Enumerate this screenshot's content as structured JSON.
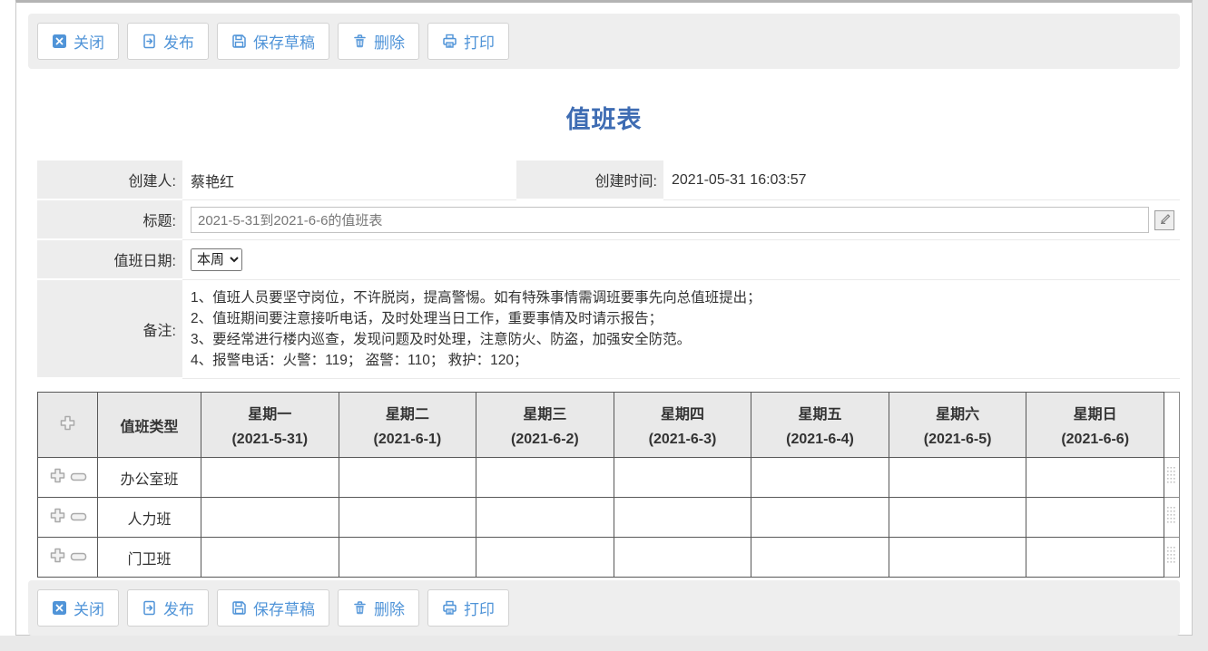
{
  "page": {
    "title": "值班表"
  },
  "colors": {
    "accent_blue": "#5094d8",
    "title_blue": "#3e6cb3"
  },
  "toolbar": {
    "buttons": [
      {
        "name": "close",
        "icon": "close-icon",
        "label": "关闭"
      },
      {
        "name": "publish",
        "icon": "publish-icon",
        "label": "发布"
      },
      {
        "name": "save-draft",
        "icon": "save-icon",
        "label": "保存草稿"
      },
      {
        "name": "delete",
        "icon": "delete-icon",
        "label": "删除"
      },
      {
        "name": "print",
        "icon": "print-icon",
        "label": "打印"
      }
    ]
  },
  "form": {
    "creator_label": "创建人:",
    "creator_value": "蔡艳红",
    "created_time_label": "创建时间:",
    "created_time_value": "2021-05-31 16:03:57",
    "title_label": "标题:",
    "title_value": "2021-5-31到2021-6-6的值班表",
    "duty_date_label": "值班日期:",
    "duty_date_value": "本周",
    "remarks_label": "备注:",
    "remarks_lines": [
      "1、值班人员要坚守岗位，不许脱岗，提高警惕。如有特殊事情需调班要事先向总值班提出；",
      "2、值班期间要注意接听电话，及时处理当日工作，重要事情及时请示报告；",
      "3、要经常进行楼内巡查，发现问题及时处理，注意防火、防盗，加强安全防范。",
      "4、报警电话：火警：119；  盗警：110；  救护：120；"
    ]
  },
  "table": {
    "type_header": "值班类型",
    "day_headers": [
      {
        "day": "星期一",
        "date": "(2021-5-31)"
      },
      {
        "day": "星期二",
        "date": "(2021-6-1)"
      },
      {
        "day": "星期三",
        "date": "(2021-6-2)"
      },
      {
        "day": "星期四",
        "date": "(2021-6-3)"
      },
      {
        "day": "星期五",
        "date": "(2021-6-4)"
      },
      {
        "day": "星期六",
        "date": "(2021-6-5)"
      },
      {
        "day": "星期日",
        "date": "(2021-6-6)"
      }
    ],
    "rows": [
      {
        "type": "办公室班"
      },
      {
        "type": "人力班"
      },
      {
        "type": "门卫班"
      }
    ]
  }
}
